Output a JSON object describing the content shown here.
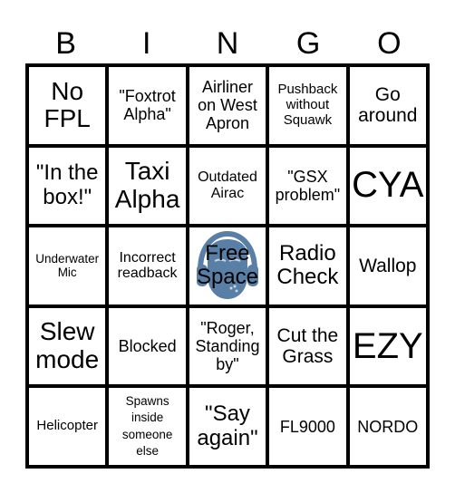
{
  "header": {
    "letters": [
      "B",
      "I",
      "N",
      "G",
      "O"
    ]
  },
  "free_space": {
    "label": "Free Space",
    "icon": "headphones-face-icon",
    "icon_color": "#5a7fa6"
  },
  "cells": [
    [
      "No FPL",
      "\"Foxtrot Alpha\"",
      "Airliner on West Apron",
      "Pushback without Squawk",
      "Go around"
    ],
    [
      "\"In the box!\"",
      "Taxi Alpha",
      "Outdated Airac",
      "\"GSX problem\"",
      "CYA"
    ],
    [
      "Underwater Mic",
      "Incorrect readback",
      "Free Space",
      "Radio Check",
      "Wallop"
    ],
    [
      "Slew mode",
      "Blocked",
      "\"Roger, Standing by\"",
      "Cut the Grass",
      "EZY"
    ],
    [
      "Helicopter",
      "Spawns inside someone else",
      "\"Say again\"",
      "FL9000",
      "NORDO"
    ]
  ]
}
